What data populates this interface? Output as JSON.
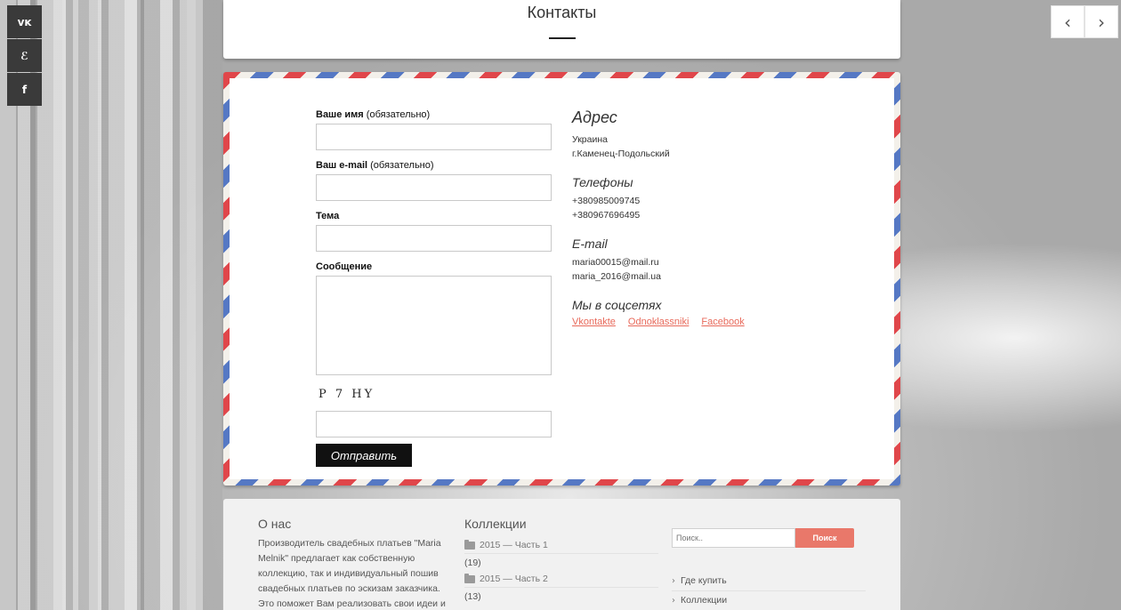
{
  "page": {
    "title": "Контакты"
  },
  "social_bar": [
    {
      "icon": "vk-icon",
      "glyph": "ᴠᴋ"
    },
    {
      "icon": "odnoklassniki-icon",
      "glyph": "ℰ"
    },
    {
      "icon": "facebook-icon",
      "glyph": "f"
    }
  ],
  "nav": {
    "prev_glyph": "‹",
    "next_glyph": "›"
  },
  "form": {
    "name_label": "Ваше имя",
    "name_note": "(обязательно)",
    "email_label": "Ваш e-mail",
    "email_note": "(обязательно)",
    "subject_label": "Тема",
    "message_label": "Сообщение",
    "captcha_text": "P 7 HY",
    "submit_label": "Отправить"
  },
  "contacts": {
    "address_heading": "Адрес",
    "address_lines": [
      "Украина",
      "г.Каменец-Подольский"
    ],
    "phones_heading": "Телефоны",
    "phones": [
      "+380985009745",
      "+380967696495"
    ],
    "email_heading": "E-mail",
    "emails": [
      "maria00015@mail.ru",
      "maria_2016@mail.ua"
    ],
    "social_heading": "Мы в соцсетях",
    "social_links": [
      "Vkontakte",
      "Odnoklassniki",
      "Facebook"
    ]
  },
  "footer": {
    "about_heading": "О нас",
    "about_text": "Производитель свадебных платьев \"Maria Melnik\" предлагает как собственную коллекцию, так и индивидуальный пошив свадебных платьев по эскизам заказчика. Это поможет Вам реализовать свои идеи и",
    "collections_heading": "Коллекции",
    "collections": [
      {
        "name": "2015 — Часть 1",
        "count": "(19)"
      },
      {
        "name": "2015 — Часть 2",
        "count": "(13)"
      }
    ],
    "search_placeholder": "Поиск..",
    "search_button": "Поиск",
    "links": [
      "Где купить",
      "Коллекции"
    ]
  },
  "colors": {
    "accent": "#e9786a",
    "link": "#e86a5b",
    "stripe_red": "#e0464a",
    "stripe_blue": "#5578c4",
    "dark_button": "#111111"
  }
}
